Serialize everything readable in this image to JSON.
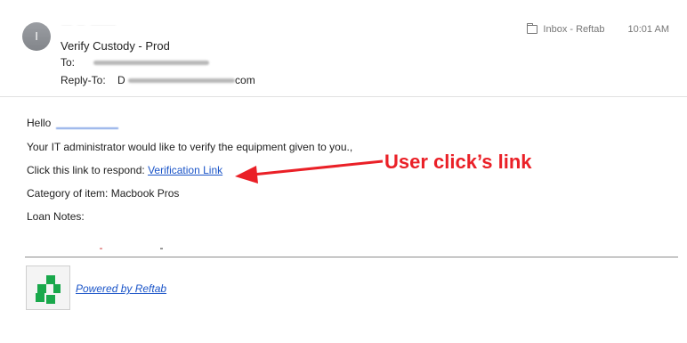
{
  "header": {
    "avatar_initial": "I",
    "subject": "Verify Custody - Prod",
    "to_label": "To:",
    "reply_to_label": "Reply-To:",
    "reply_to_value_prefix": "D",
    "reply_to_value_suffix": "com",
    "folder_label": "Inbox - Reftab",
    "time": "10:01 AM"
  },
  "body": {
    "greeting": "Hello",
    "line1": "Your IT administrator would like to verify the equipment given to you.,",
    "line2_prefix": "Click this link to respond:",
    "link_text": "Verification Link",
    "line3": "Category of item: Macbook Pros",
    "line4": "Loan Notes:"
  },
  "annotation": {
    "text": "User click’s link",
    "color": "#ea2027"
  },
  "footer": {
    "powered_by": "Powered by Reftab",
    "logo_color": "#19a84b"
  },
  "icons": [
    "folder-icon",
    "arrow-icon",
    "reftab-logo-icon"
  ]
}
